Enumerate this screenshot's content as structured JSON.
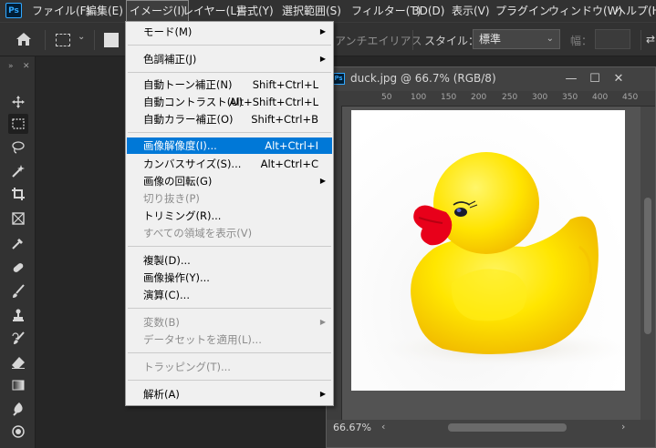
{
  "app": {
    "logo": "Ps",
    "accent_color": "#31a8ff"
  },
  "menubar": {
    "items": [
      {
        "label": "ファイル(F)"
      },
      {
        "label": "編集(E)"
      },
      {
        "label": "イメージ(I)"
      },
      {
        "label": "レイヤー(L)"
      },
      {
        "label": "書式(Y)"
      },
      {
        "label": "選択範囲(S)"
      },
      {
        "label": "フィルター(T)"
      },
      {
        "label": "3D(D)"
      },
      {
        "label": "表示(V)"
      },
      {
        "label": "プラグイン"
      },
      {
        "label": "ウィンドウ(W)"
      },
      {
        "label": "ヘルプ(H)"
      }
    ]
  },
  "options": {
    "anti_alias_label": "アンチエイリアス",
    "style_label": "スタイル：",
    "style_value": "標準",
    "width_label": "幅："
  },
  "document": {
    "title": "duck.jpg @ 66.7% (RGB/8)",
    "zoom_display": "66.67%",
    "ruler_ticks": [
      "50",
      "100",
      "150",
      "200",
      "250",
      "300",
      "350",
      "400",
      "450"
    ]
  },
  "image_menu": {
    "items": [
      {
        "label": "モード(M)",
        "shortcut": "",
        "submenu": true,
        "disabled": false,
        "highlighted": false
      },
      {
        "label": "色調補正(J)",
        "shortcut": "",
        "submenu": true,
        "disabled": false,
        "highlighted": false
      },
      {
        "label": "自動トーン補正(N)",
        "shortcut": "Shift+Ctrl+L",
        "submenu": false,
        "disabled": false,
        "highlighted": false
      },
      {
        "label": "自動コントラスト(U)",
        "shortcut": "Alt+Shift+Ctrl+L",
        "submenu": false,
        "disabled": false,
        "highlighted": false
      },
      {
        "label": "自動カラー補正(O)",
        "shortcut": "Shift+Ctrl+B",
        "submenu": false,
        "disabled": false,
        "highlighted": false
      },
      {
        "label": "画像解像度(I)...",
        "shortcut": "Alt+Ctrl+I",
        "submenu": false,
        "disabled": false,
        "highlighted": true
      },
      {
        "label": "カンバスサイズ(S)...",
        "shortcut": "Alt+Ctrl+C",
        "submenu": false,
        "disabled": false,
        "highlighted": false
      },
      {
        "label": "画像の回転(G)",
        "shortcut": "",
        "submenu": true,
        "disabled": false,
        "highlighted": false
      },
      {
        "label": "切り抜き(P)",
        "shortcut": "",
        "submenu": false,
        "disabled": true,
        "highlighted": false
      },
      {
        "label": "トリミング(R)...",
        "shortcut": "",
        "submenu": false,
        "disabled": false,
        "highlighted": false
      },
      {
        "label": "すべての領域を表示(V)",
        "shortcut": "",
        "submenu": false,
        "disabled": true,
        "highlighted": false
      },
      {
        "label": "複製(D)...",
        "shortcut": "",
        "submenu": false,
        "disabled": false,
        "highlighted": false
      },
      {
        "label": "画像操作(Y)...",
        "shortcut": "",
        "submenu": false,
        "disabled": false,
        "highlighted": false
      },
      {
        "label": "演算(C)...",
        "shortcut": "",
        "submenu": false,
        "disabled": false,
        "highlighted": false
      },
      {
        "label": "変数(B)",
        "shortcut": "",
        "submenu": true,
        "disabled": true,
        "highlighted": false
      },
      {
        "label": "データセットを適用(L)...",
        "shortcut": "",
        "submenu": false,
        "disabled": true,
        "highlighted": false
      },
      {
        "label": "トラッピング(T)...",
        "shortcut": "",
        "submenu": false,
        "disabled": true,
        "highlighted": false
      },
      {
        "label": "解析(A)",
        "shortcut": "",
        "submenu": true,
        "disabled": false,
        "highlighted": false
      }
    ]
  },
  "tools": [
    "move-tool-icon",
    "rectangular-marquee-icon",
    "lasso-icon",
    "magic-wand-icon",
    "crop-icon",
    "frame-icon",
    "eyedropper-icon",
    "healing-brush-icon",
    "brush-icon",
    "clone-stamp-icon",
    "history-brush-icon",
    "eraser-icon",
    "gradient-icon",
    "blur-icon",
    "dodge-icon"
  ]
}
